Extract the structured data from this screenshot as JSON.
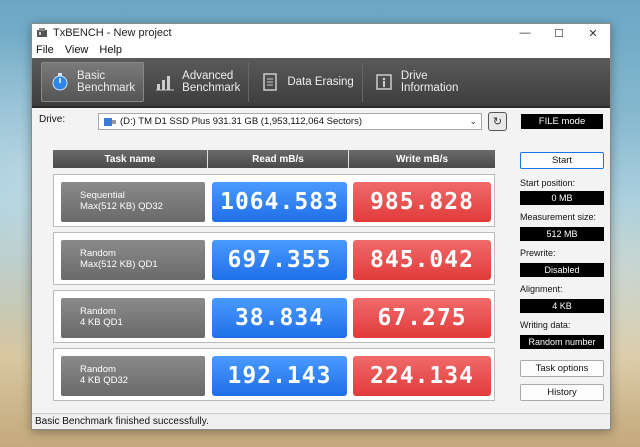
{
  "window": {
    "title": "TxBENCH - New project"
  },
  "menu": [
    "File",
    "View",
    "Help"
  ],
  "toolbar": [
    {
      "line1": "Basic",
      "line2": "Benchmark",
      "active": true,
      "icon": "stopwatch-icon"
    },
    {
      "line1": "Advanced",
      "line2": "Benchmark",
      "active": false,
      "icon": "bar-chart-icon"
    },
    {
      "line1": "Data Erasing",
      "line2": "",
      "active": false,
      "icon": "eraser-icon"
    },
    {
      "line1": "Drive",
      "line2": "Information",
      "active": false,
      "icon": "info-icon"
    }
  ],
  "drive": {
    "label": "Drive:",
    "selected": "(D:) TM D1 SSD Plus  931.31 GB (1,953,112,064 Sectors)",
    "mode": "FILE mode"
  },
  "table": {
    "headers": [
      "Task name",
      "Read mB/s",
      "Write mB/s"
    ],
    "rows": [
      {
        "line1": "Sequential",
        "line2": "Max(512 KB) QD32",
        "read": "1064.583",
        "write": "985.828"
      },
      {
        "line1": "Random",
        "line2": "Max(512 KB) QD1",
        "read": "697.355",
        "write": "845.042"
      },
      {
        "line1": "Random",
        "line2": "4 KB QD1",
        "read": "38.834",
        "write": "67.275"
      },
      {
        "line1": "Random",
        "line2": "4 KB QD32",
        "read": "192.143",
        "write": "224.134"
      }
    ]
  },
  "side": {
    "start": "Start",
    "start_position_label": "Start position:",
    "start_position": "0 MB",
    "measurement_size_label": "Measurement size:",
    "measurement_size": "512 MB",
    "prewrite_label": "Prewrite:",
    "prewrite": "Disabled",
    "alignment_label": "Alignment:",
    "alignment": "4 KB",
    "writing_data_label": "Writing data:",
    "writing_data": "Random number",
    "task_options": "Task options",
    "history": "History"
  },
  "status": "Basic Benchmark finished successfully."
}
